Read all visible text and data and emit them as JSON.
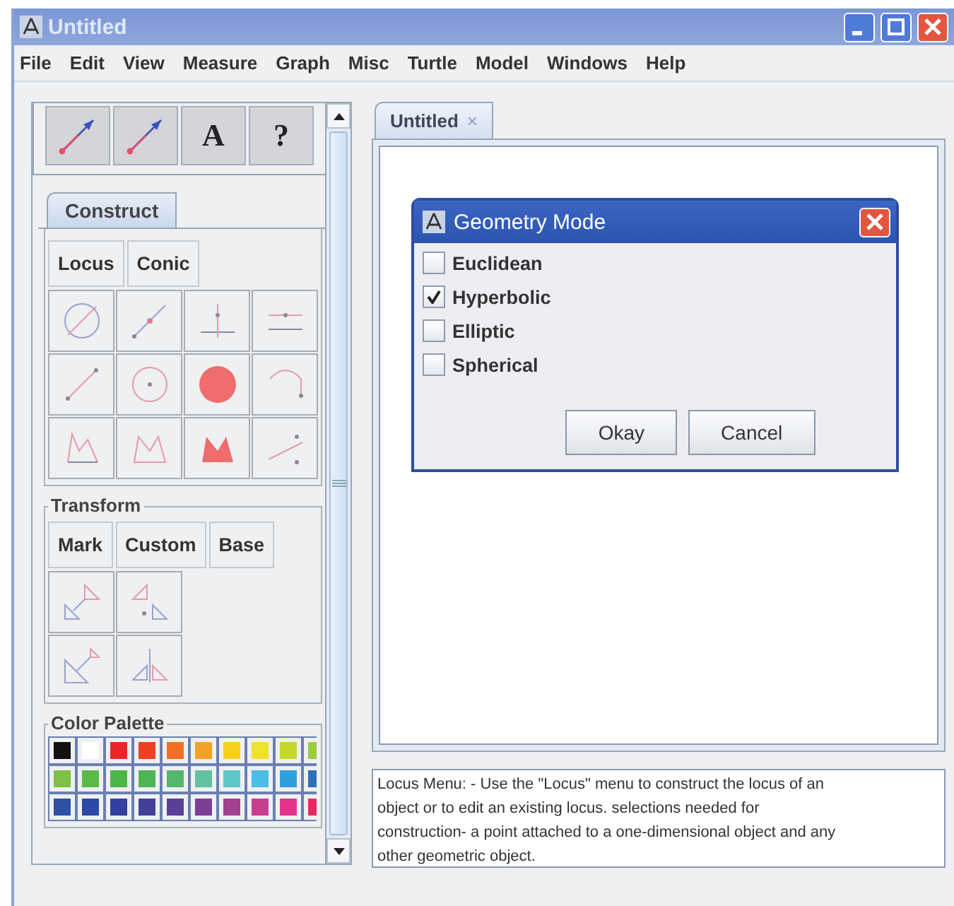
{
  "window": {
    "title": "Untitled"
  },
  "menu": [
    "File",
    "Edit",
    "View",
    "Measure",
    "Graph",
    "Misc",
    "Turtle",
    "Model",
    "Windows",
    "Help"
  ],
  "toolbar": {
    "text_buttons": [
      "A",
      "?"
    ]
  },
  "construct": {
    "tab": "Construct",
    "buttons": [
      "Locus",
      "Conic"
    ]
  },
  "transform": {
    "title": "Transform",
    "buttons": [
      "Mark",
      "Custom",
      "Base"
    ]
  },
  "palette": {
    "title": "Color Palette",
    "swatches": [
      {
        "color": "#111111"
      },
      {
        "color": "#ffffff"
      },
      {
        "color": "#e8262a"
      },
      {
        "color": "#ee4124"
      },
      {
        "color": "#f26f22"
      },
      {
        "color": "#f7a028"
      },
      {
        "color": "#f7d11c"
      },
      {
        "color": "#eee32a"
      },
      {
        "color": "#c4d72c"
      },
      {
        "color": "#9ccb3b"
      },
      {
        "color": "#7dc243"
      },
      {
        "color": "#5bb946"
      },
      {
        "color": "#4cb749"
      },
      {
        "color": "#4db556"
      },
      {
        "color": "#55b66f"
      },
      {
        "color": "#63c1a0"
      },
      {
        "color": "#5fc7c9"
      },
      {
        "color": "#4bbde6"
      },
      {
        "color": "#2f9fe0"
      },
      {
        "color": "#2e70b9"
      },
      {
        "color": "#2e51a3"
      },
      {
        "color": "#2d48a5"
      },
      {
        "color": "#3240a0"
      },
      {
        "color": "#44409a"
      },
      {
        "color": "#5a3f98"
      },
      {
        "color": "#7d3e98"
      },
      {
        "color": "#a1418f"
      },
      {
        "color": "#c83f8f"
      },
      {
        "color": "#e2348b"
      },
      {
        "color": "#e92a5f"
      }
    ]
  },
  "document_tab": {
    "label": "Untitled",
    "close": "×",
    "selected": true
  },
  "dialog": {
    "title": "Geometry Mode",
    "options": [
      {
        "label": "Euclidean",
        "checked": false
      },
      {
        "label": "Hyperbolic",
        "checked": true
      },
      {
        "label": "Elliptic",
        "checked": false
      },
      {
        "label": "Spherical",
        "checked": false
      }
    ],
    "buttons": [
      "Okay",
      "Cancel"
    ]
  },
  "help_lines": [
    "Locus Menu: - Use the \"Locus\" menu to construct the locus of an",
    "object or to edit an existing locus. selections needed for",
    "construction- a point attached to a one-dimensional object and any",
    "other geometric object."
  ]
}
